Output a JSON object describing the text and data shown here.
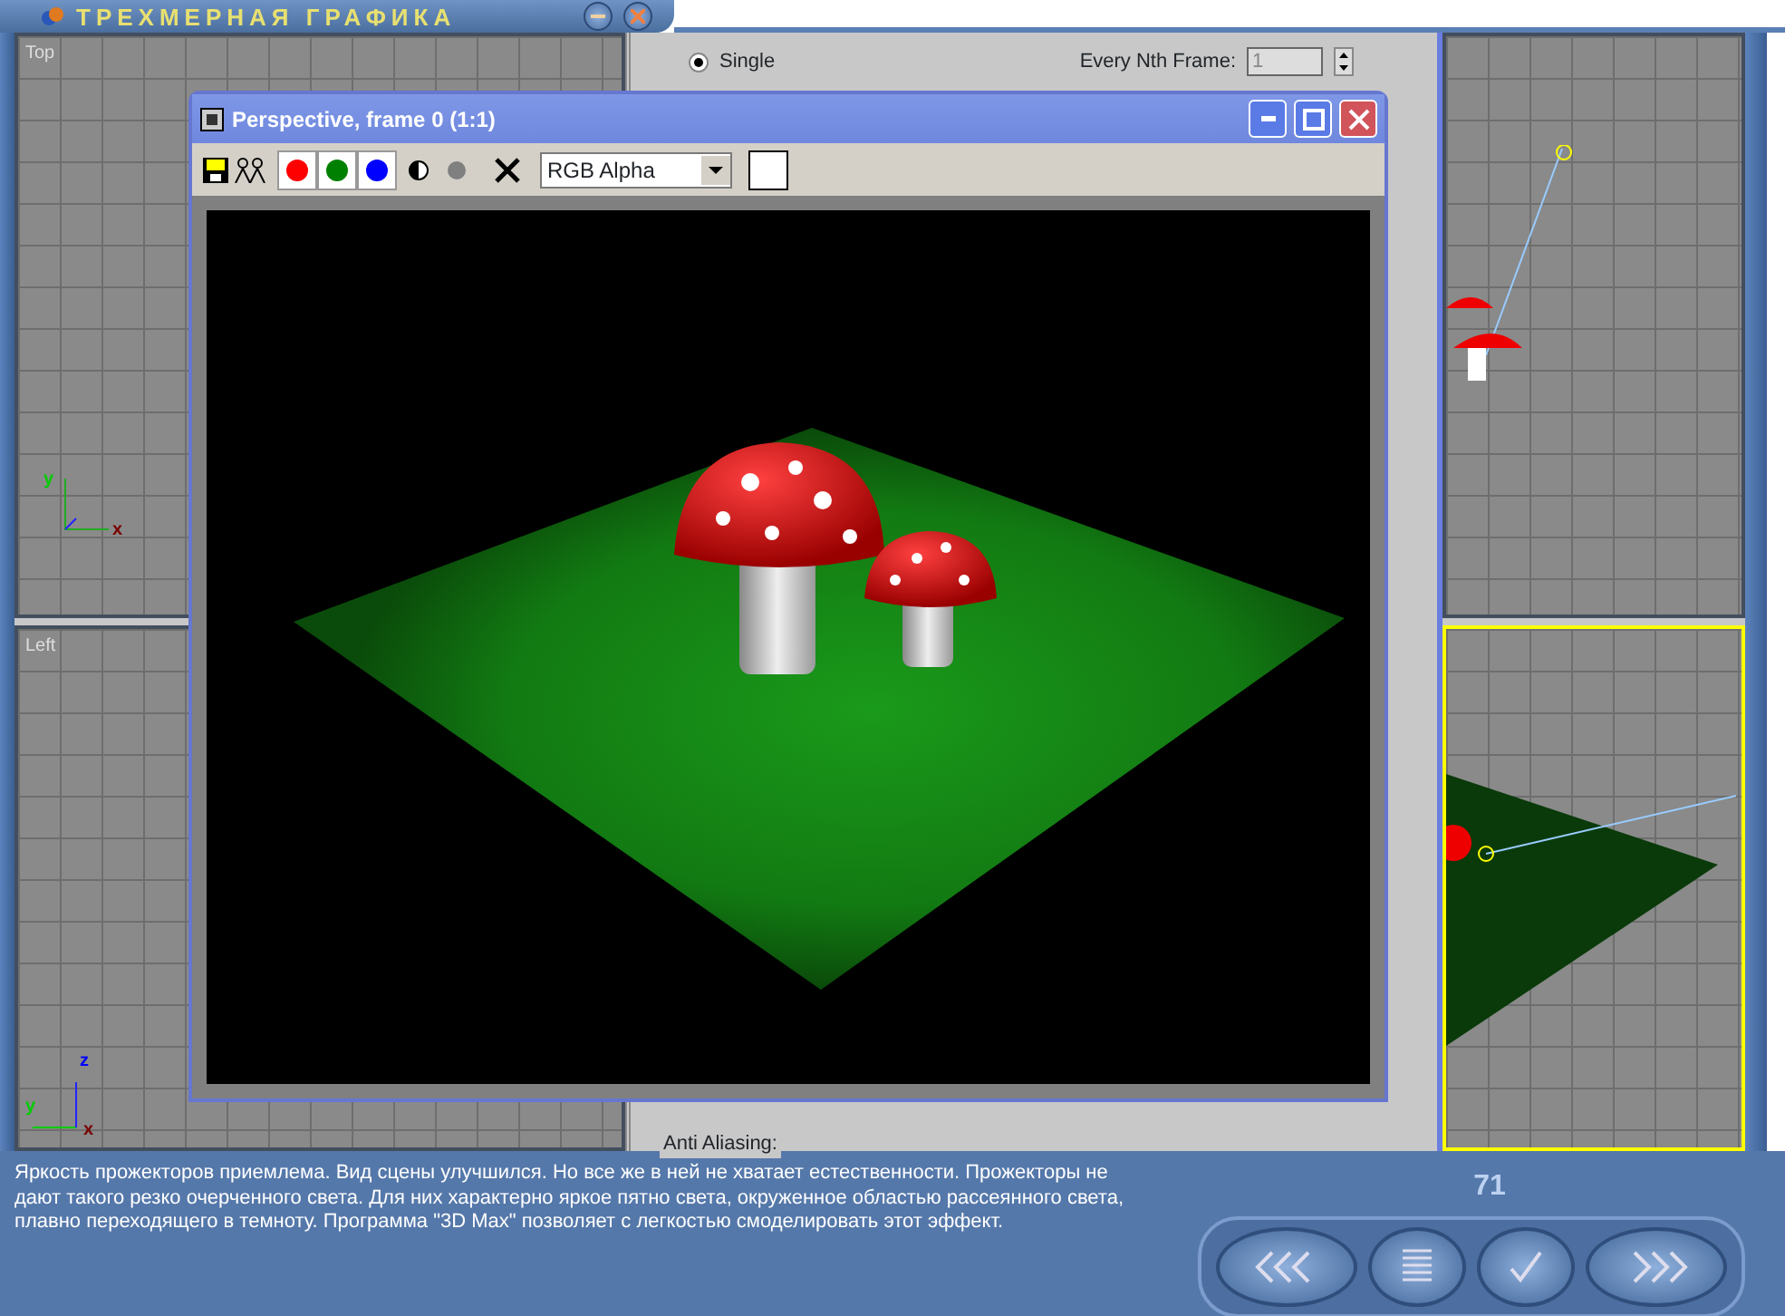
{
  "app": {
    "title": "ТРЕХМЕРНАЯ ГРАФИКА"
  },
  "viewports": [
    {
      "label": "Top",
      "axis_labels": [
        {
          "text": "y",
          "color": "#00cc00"
        },
        {
          "text": "x",
          "color": "#7a0000"
        }
      ]
    },
    {
      "label": "Left",
      "axis_labels": [
        {
          "text": "z",
          "color": "#0000ff"
        },
        {
          "text": "y",
          "color": "#00cc00"
        },
        {
          "text": "x",
          "color": "#7a0000"
        }
      ]
    }
  ],
  "render_settings": {
    "range_option": {
      "label": "Single",
      "selected": true
    },
    "nth_frame": {
      "label": "Every Nth Frame:",
      "value": "1"
    },
    "group_label": "Anti Aliasing:"
  },
  "render_window": {
    "title": "Perspective, frame 0 (1:1)",
    "channel_select": "RGB Alpha",
    "channels": [
      {
        "color": "#ff0000"
      },
      {
        "color": "#008000"
      },
      {
        "color": "#0000ff"
      }
    ]
  },
  "caption": {
    "text": "Яркость прожекторов приемлема. Вид сцены улучшился. Но все же в ней не хватает естественности. Прожекторы не дают такого резко очерченного света. Для них характерно яркое пятно света, окруженное областью рассеянного света, плавно переходящего в темноту. Программа \"3D Max\" позволяет с легкостью смоделировать этот эффект."
  },
  "page_number": "71"
}
